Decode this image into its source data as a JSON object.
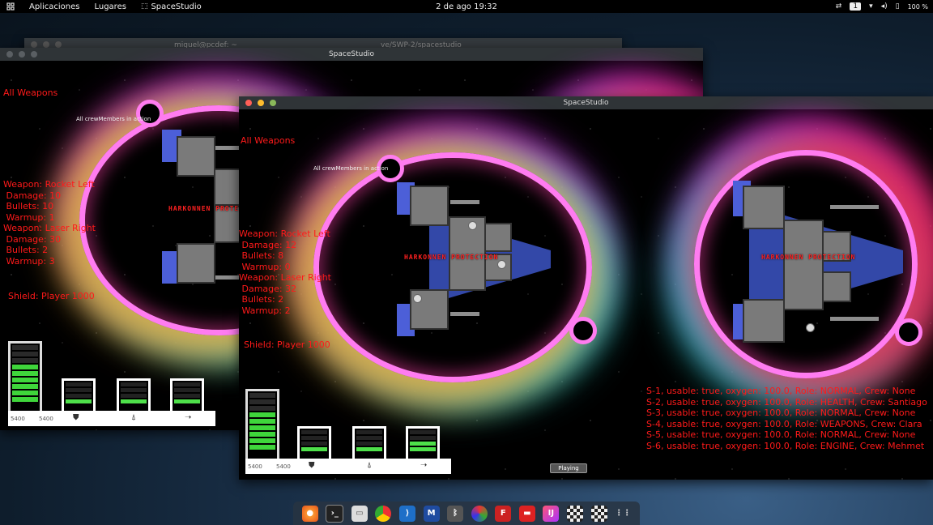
{
  "topbar": {
    "activities_icon": "grid-icon",
    "menus": [
      "Aplicaciones",
      "Lugares"
    ],
    "app_name": "SpaceStudio",
    "clock": "2 de ago  19:32",
    "workspace": "1",
    "battery": "100 %"
  },
  "terminal": {
    "title_left": "miguel@pcdef: ~",
    "title_right": "ve/SWP-2/spacestudio"
  },
  "window_back": {
    "title": "SpaceStudio",
    "all_weapons": "All Weapons",
    "crew_note": "All crewMembers in action",
    "ship_name": "HARKONNEN PROTECTION",
    "weapon_stats": "Weapon: Rocket Left\n Damage: 10\n Bullets: 10\n Warmup: 1\nWeapon: Laser Right\n Damage: 30\n Bullets: 2\n Warmup: 3",
    "shield": "Shield: Player 1000",
    "hud": {
      "num1": "5400",
      "num2": "5400"
    }
  },
  "window_front": {
    "title": "SpaceStudio",
    "all_weapons": "All Weapons",
    "crew_note": "All crewMembers in action",
    "ship_name_player": "HARKONNEN PROTECTION",
    "ship_name_enemy": "HARKONNEN PROTECTION",
    "weapon_stats": "Weapon: Rocket Left\n Damage: 12\n Bullets: 8\n Warmup: 0\nWeapon: Laser Right\n Damage: 32\n Bullets: 2\n Warmup: 2",
    "shield": "Shield: Player 1000",
    "status_button": "Playing",
    "sections": [
      "S-1, usable: true, oxygen: 100.0, Role: NORMAL, Crew: None",
      "S-2, usable: true, oxygen: 100.0, Role: HEALTH, Crew: Santiago",
      "S-3, usable: true, oxygen: 100.0, Role: NORMAL, Crew: None",
      "S-4, usable: true, oxygen: 100.0, Role: WEAPONS, Crew: Clara",
      "S-5, usable: true, oxygen: 100.0, Role: NORMAL, Crew: None",
      "S-6, usable: true, oxygen: 100.0, Role: ENGINE, Crew: Mehmet"
    ],
    "hud": {
      "num1": "5400",
      "num2": "5400"
    }
  },
  "dock": {
    "apps": [
      "firefox-icon",
      "terminal-icon",
      "files-icon",
      "chrome-icon",
      "vscode-icon",
      "malwarebytes-icon",
      "bluetooth-icon",
      "color-icon",
      "filezilla-icon",
      "red-app-icon",
      "intellij-icon",
      "mosaic-icon",
      "mosaic-icon",
      "app-grid-icon"
    ]
  }
}
